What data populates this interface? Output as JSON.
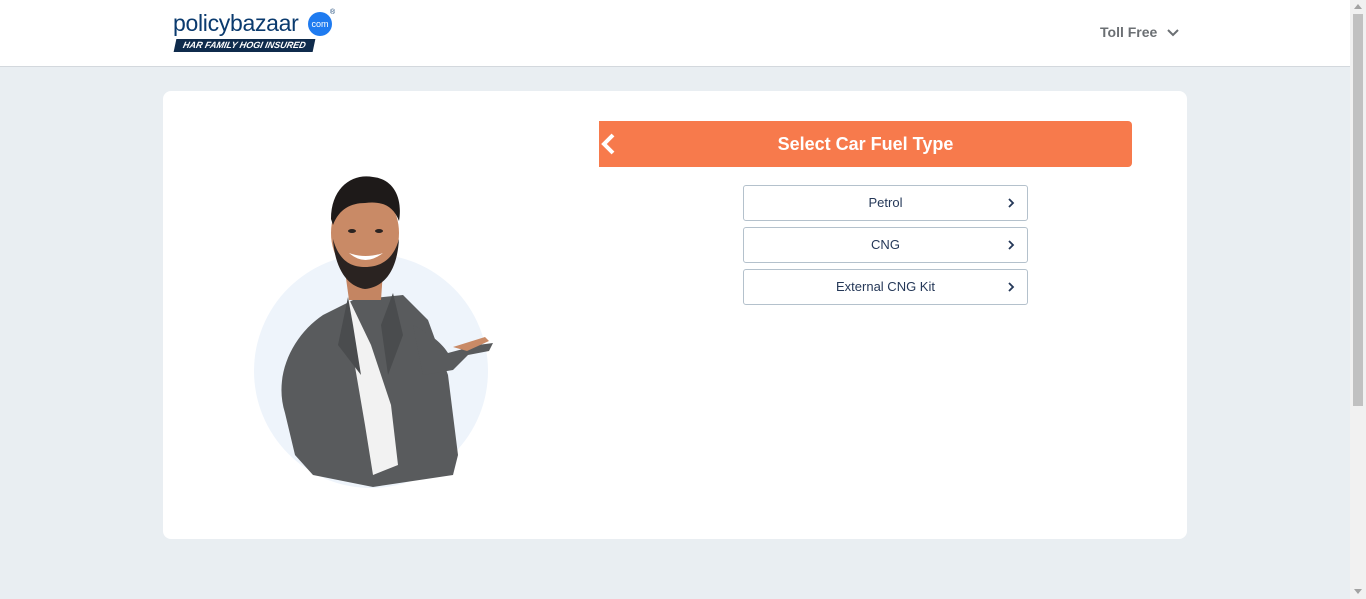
{
  "header": {
    "logo": {
      "word": "policybazaar",
      "dot": "com",
      "reg": "®",
      "tagline": "HAR FAMILY HOGI INSURED"
    },
    "toll_free": "Toll Free"
  },
  "panel": {
    "title": "Select Car Fuel Type",
    "options": [
      {
        "label": "Petrol"
      },
      {
        "label": "CNG"
      },
      {
        "label": "External CNG Kit"
      }
    ]
  },
  "colors": {
    "accent": "#f77a4c",
    "brand_navy": "#0f2b4c",
    "brand_blue": "#1f7bf0",
    "page_bg": "#e9eef2"
  },
  "icons": {
    "back": "chevron-left-icon",
    "toll_free": "chevron-down-icon",
    "option": "chevron-right-icon"
  }
}
